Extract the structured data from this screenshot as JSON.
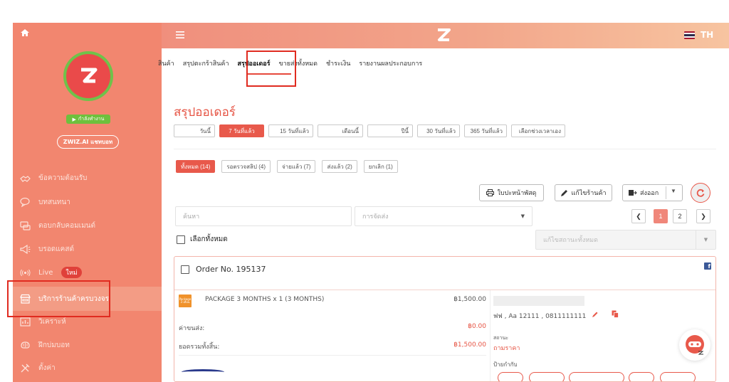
{
  "sidebar": {
    "status_label": "กำลังทำงาน",
    "chat_button": "ZWIZ.AI แชทบอท",
    "items": [
      {
        "label": "ข้อความต้อนรับ",
        "icon": "handshake-icon"
      },
      {
        "label": "บทสนทนา",
        "icon": "chat-bubbles-icon"
      },
      {
        "label": "ตอบกลับคอมเมนต์",
        "icon": "comment-reply-icon"
      },
      {
        "label": "บรอดแคสต์",
        "icon": "megaphone-icon"
      },
      {
        "label": "Live",
        "icon": "live-broadcast-icon",
        "badge": "ใหม่"
      },
      {
        "label": "บริการร้านค้าครบวงจร",
        "icon": "store-icon"
      },
      {
        "label": "วิเคราะห์",
        "icon": "analytics-icon"
      },
      {
        "label": "ฝึกบ่มบอท",
        "icon": "brain-icon"
      },
      {
        "label": "ตั้งค่า",
        "icon": "settings-tools-icon"
      }
    ]
  },
  "header": {
    "language": "TH"
  },
  "tabs": [
    {
      "label": "สินค้า"
    },
    {
      "label": "สรุปตะกร้าสินค้า"
    },
    {
      "label": "สรุปออเดอร์"
    },
    {
      "label": "ขายส่งทั้งหมด"
    },
    {
      "label": "ชำระเงิน"
    },
    {
      "label": "รายงานผลประกอบการ"
    }
  ],
  "main": {
    "title": "สรุปออเดอร์",
    "date_ranges": [
      "วันนี้",
      "7 วันที่แล้ว",
      "15 วันที่แล้ว",
      "เดือนนี้",
      "ปีนี้",
      "30 วันที่แล้ว",
      "365 วันที่แล้ว",
      "เลือกช่วงเวลาเอง"
    ],
    "status_filters": [
      "ทั้งหมด (14)",
      "รอตรวจสลิป (4)",
      "จ่ายแล้ว (7)",
      "ส่งแล้ว (2)",
      "ยกเลิก (1)"
    ],
    "print_label": "ใบปะหน้าพัสดุ",
    "edit_store_label": "แก้ไขร้านค้า",
    "export_label": "ส่งออก",
    "search_placeholder": "ค้นหา",
    "shipping_placeholder": "การจัดส่ง",
    "pages": [
      "1",
      "2"
    ],
    "select_all_label": "เลือกทั้งหมด",
    "bulk_status_placeholder": "แก้ไขสถานะทั้งหมด"
  },
  "order": {
    "title": "Order No. 195137",
    "thumb_text": "Package 3 เดือน",
    "item_line": "PACKAGE 3 MONTHS x 1 (3 MONTHS)",
    "item_price": "฿1,500.00",
    "shipping_label": "ค่าขนส่ง:",
    "shipping_price": "฿0.00",
    "total_label": "ยอดรวมทั้งสิ้น:",
    "total_price": "฿1,500.00",
    "address": "ฟฟ , Aa 12111 , 0811111111",
    "status_heading": "สถานะ",
    "status_value": "ถามราคา",
    "tag_heading": "ป้ายกำกับ"
  },
  "colors": {
    "accent": "#e8594b",
    "sidebar": "#f2866f",
    "highlight_box": "#e02b20"
  }
}
